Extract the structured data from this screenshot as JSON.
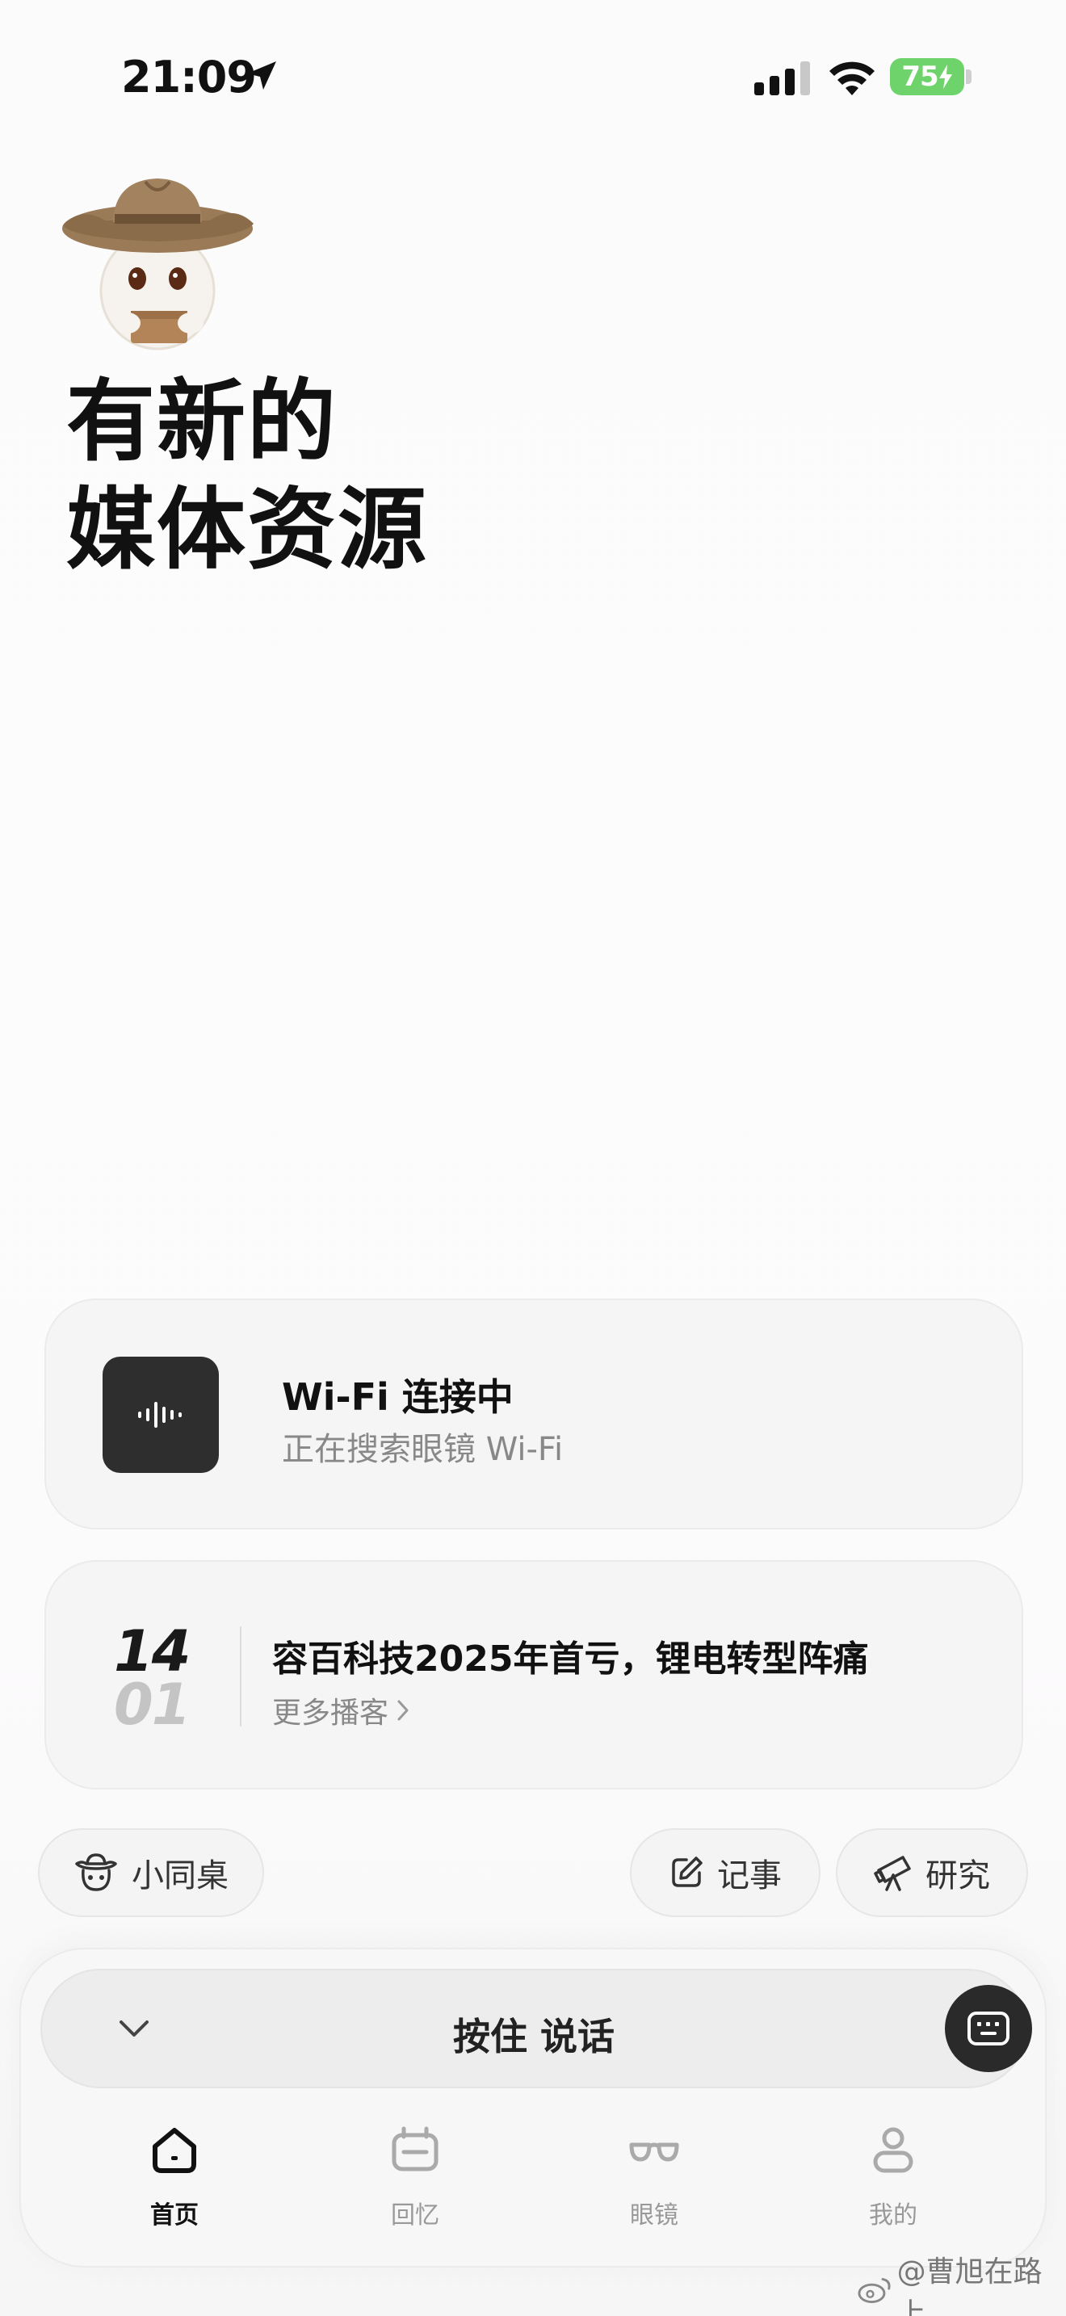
{
  "status_bar": {
    "time": "21:09",
    "battery": "75"
  },
  "hero": {
    "line1": "有新的",
    "line2": "媒体资源",
    "mascot_icon": "cowboy-mascot-icon"
  },
  "wifi_card": {
    "title": "Wi-Fi 连接中",
    "subtitle": "正在搜索眼镜 Wi-Fi",
    "icon": "audio-wave-icon"
  },
  "news_card": {
    "day": "14",
    "month": "01",
    "title": "容百科技2025年首亏，锂电转型阵痛",
    "more": "更多播客"
  },
  "chips": {
    "desk": "小同桌",
    "note": "记事",
    "research": "研究"
  },
  "voice": {
    "label": "按住 说话"
  },
  "tabs": [
    {
      "label": "首页",
      "icon": "home-icon",
      "active": true
    },
    {
      "label": "回忆",
      "icon": "memory-icon",
      "active": false
    },
    {
      "label": "眼镜",
      "icon": "glasses-icon",
      "active": false
    },
    {
      "label": "我的",
      "icon": "profile-icon",
      "active": false
    }
  ],
  "watermark": "@曹旭在路上",
  "colors": {
    "battery": "#6fd36b",
    "dark_button": "#2a2a2a",
    "card_bg": "#f5f5f5"
  }
}
